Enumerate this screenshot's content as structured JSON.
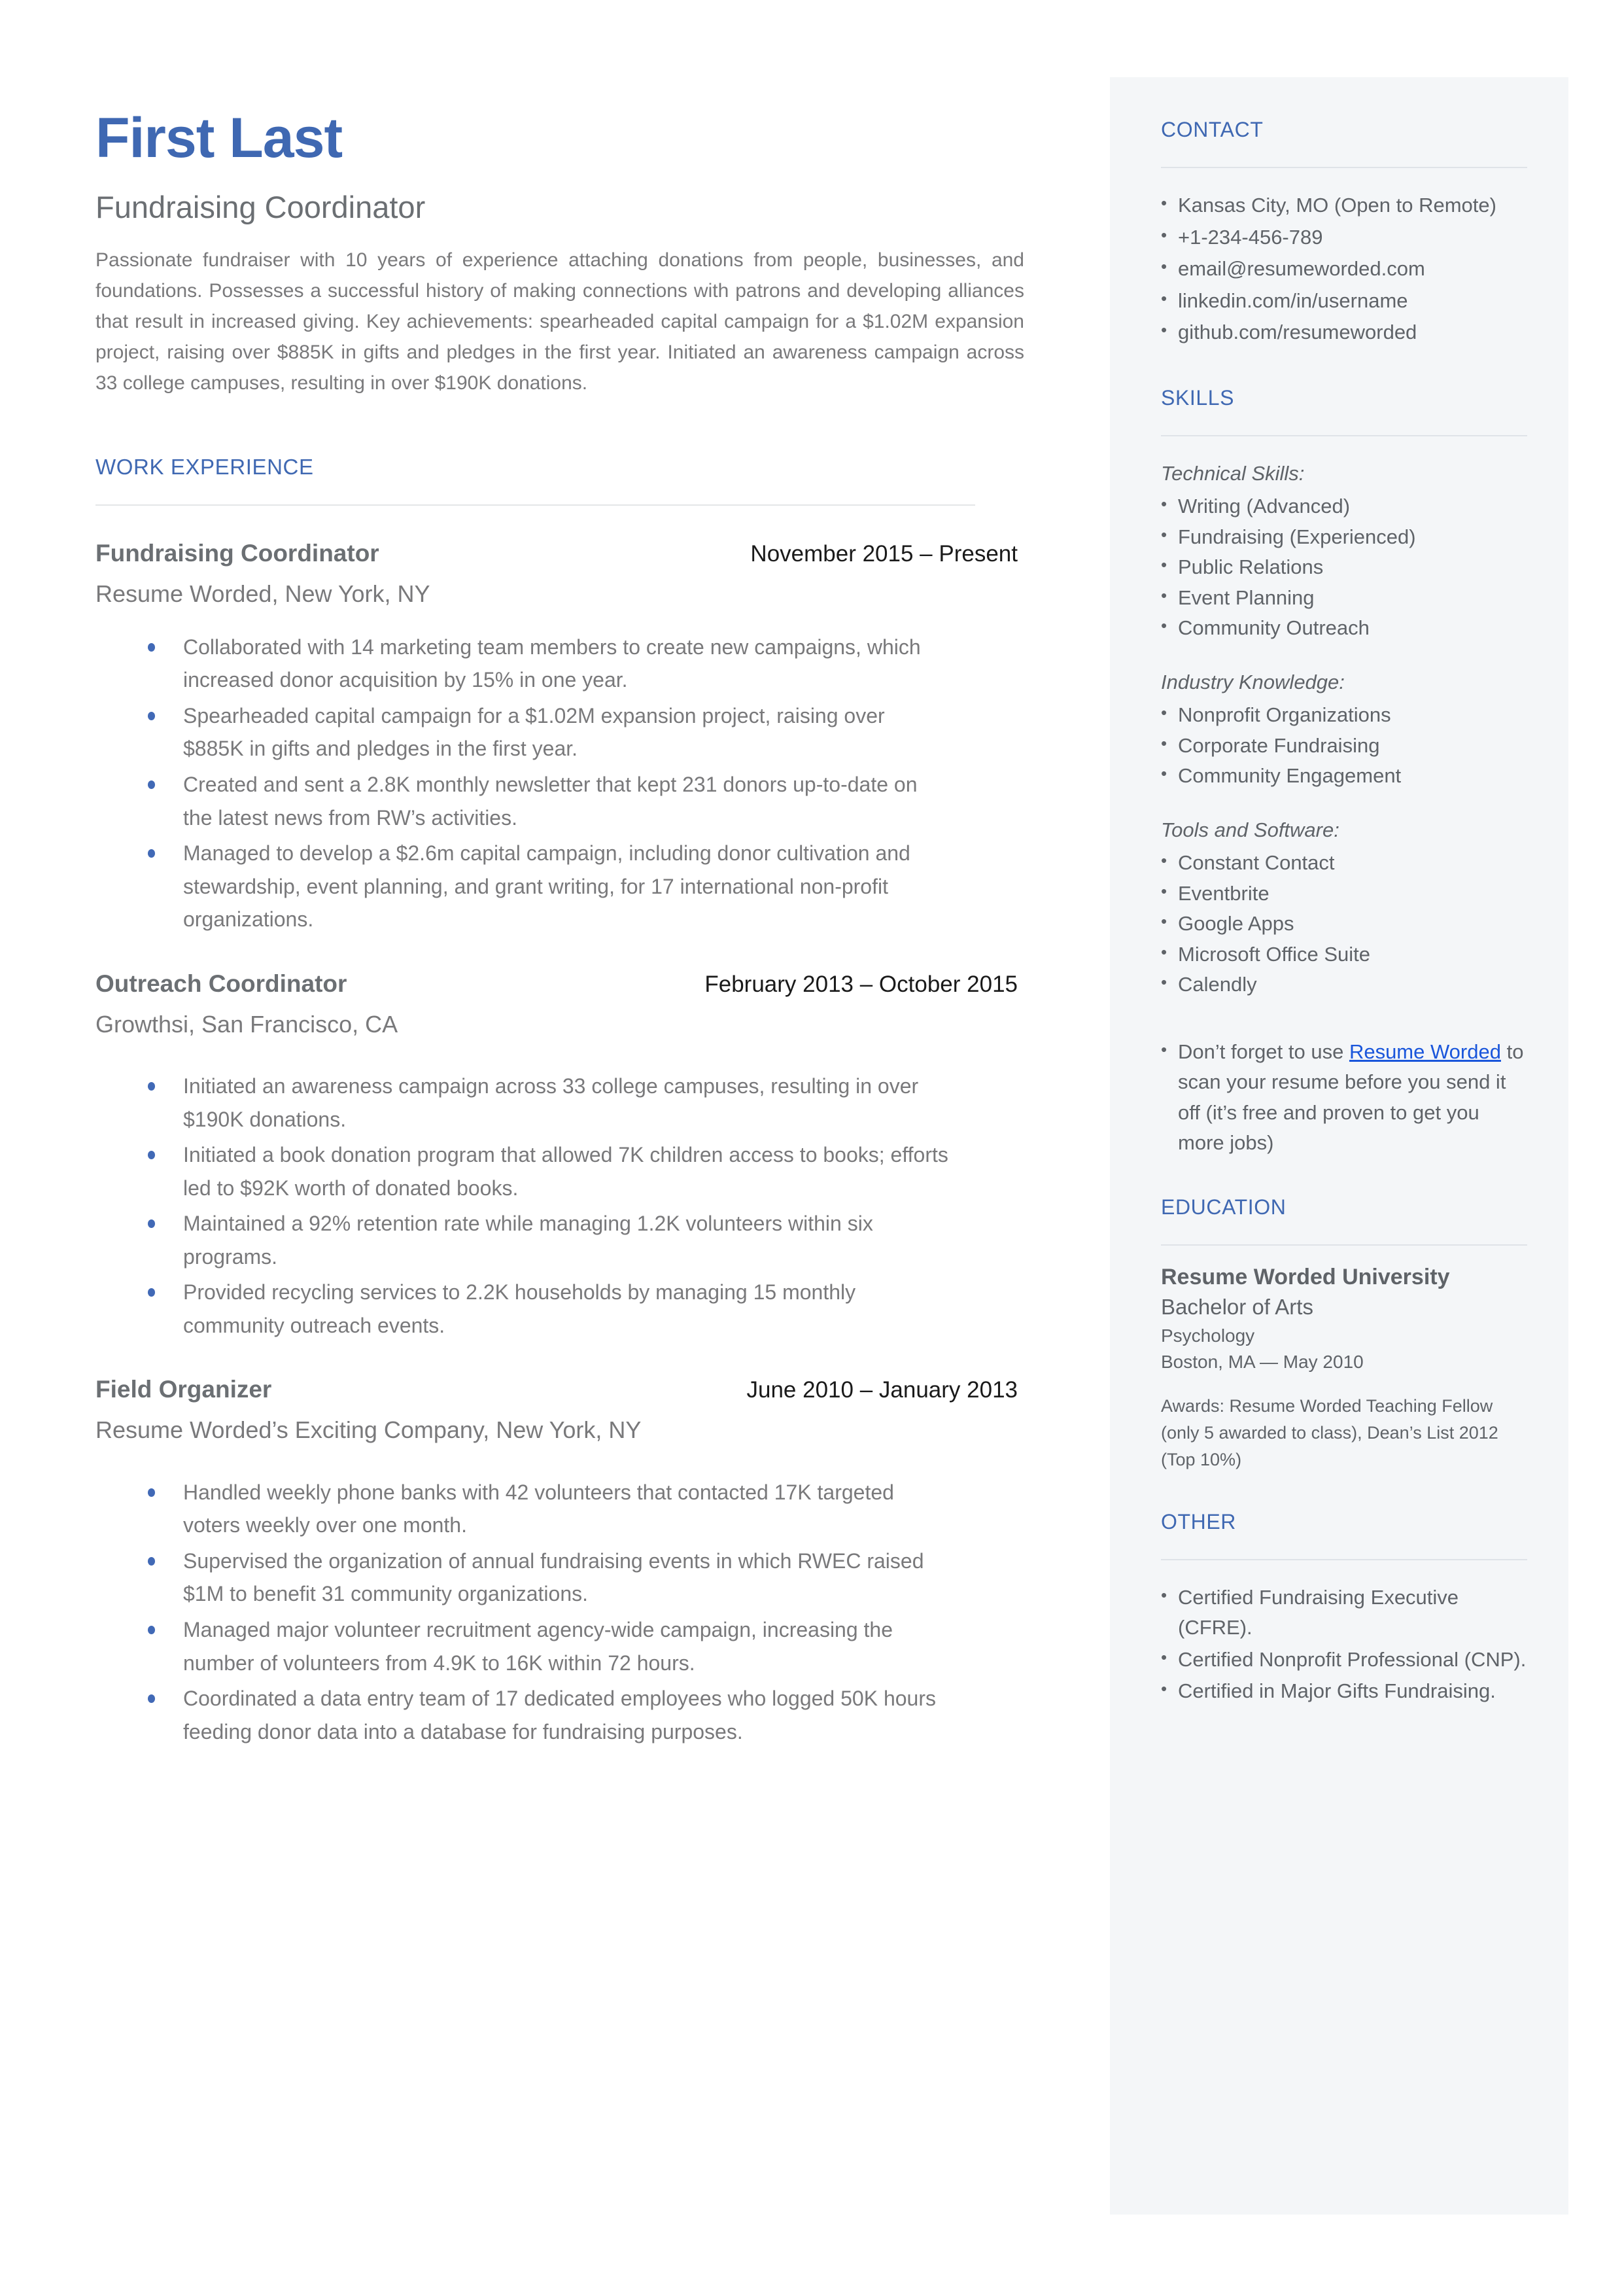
{
  "colors": {
    "accent_blue": "#3f68b2",
    "bullet_blue": "#4169b6",
    "link_blue": "#1a56db",
    "body_gray": "#79797b",
    "sidebar_bg": "#f4f6f8"
  },
  "header": {
    "name": "First Last",
    "role": "Fundraising Coordinator",
    "summary": "Passionate fundraiser with 10 years of experience attaching donations from people, businesses, and foundations. Possesses a successful history of making connections with patrons and developing alliances that result in increased giving. Key achievements: spearheaded capital campaign for a $1.02M expansion project, raising over $885K in gifts and pledges in the first year. Initiated an awareness campaign across 33 college campuses, resulting in over $190K donations."
  },
  "work_experience": {
    "heading": "WORK EXPERIENCE",
    "jobs": [
      {
        "title": "Fundraising Coordinator",
        "dates": "November 2015 – Present",
        "company": "Resume Worded, New York, NY",
        "bullets": [
          "Collaborated with 14 marketing team members to create new campaigns, which increased donor acquisition by 15% in one year.",
          "Spearheaded capital campaign for a $1.02M expansion project, raising over $885K in gifts and pledges in the first year.",
          "Created and sent a 2.8K monthly newsletter that kept 231 donors up-to-date on the latest news from RW’s activities.",
          "Managed to develop a $2.6m capital campaign, including donor cultivation and stewardship, event planning, and grant writing, for 17 international non-profit organizations."
        ]
      },
      {
        "title": "Outreach Coordinator",
        "dates": "February 2013 – October 2015",
        "company": "Growthsi, San Francisco, CA",
        "bullets": [
          "Initiated an awareness campaign across 33 college campuses, resulting in over $190K donations.",
          "Initiated a book donation program that allowed 7K children access to books; efforts led to $92K worth of donated books.",
          "Maintained a 92% retention rate while managing 1.2K volunteers within six programs.",
          "Provided recycling services to  2.2K households by managing 15 monthly community outreach events."
        ]
      },
      {
        "title": "Field Organizer",
        "dates": "June 2010 – January 2013",
        "company": "Resume Worded’s Exciting Company, New York, NY",
        "bullets": [
          "Handled weekly phone banks with 42 volunteers that contacted 17K targeted voters weekly over one month.",
          "Supervised the organization of annual fundraising events in which RWEC raised $1M to benefit 31 community organizations.",
          "Managed major volunteer recruitment agency-wide campaign, increasing the number of volunteers from  4.9K to 16K within 72 hours.",
          "Coordinated a data entry team of 17 dedicated employees who logged 50K hours feeding donor data into a database for fundraising purposes."
        ]
      }
    ]
  },
  "sidebar": {
    "contact": {
      "heading": "CONTACT",
      "items": [
        "Kansas City, MO (Open to Remote)",
        "+1-234-456-789",
        "email@resumeworded.com",
        "linkedin.com/in/username",
        "github.com/resumeworded"
      ]
    },
    "skills": {
      "heading": "SKILLS",
      "groups": [
        {
          "label": "Technical Skills:",
          "items": [
            "Writing (Advanced)",
            "Fundraising (Experienced)",
            "Public Relations",
            "Event Planning",
            "Community Outreach"
          ]
        },
        {
          "label": "Industry Knowledge:",
          "items": [
            "Nonprofit Organizations",
            "Corporate Fundraising",
            "Community Engagement"
          ]
        },
        {
          "label": "Tools and Software:",
          "items": [
            "Constant Contact",
            "Eventbrite",
            "Google Apps",
            "Microsoft Office Suite",
            "Calendly"
          ]
        }
      ],
      "promo": {
        "before": "Don’t forget to use ",
        "link": "Resume Worded",
        "after": " to scan your resume before you send it off (it’s free and proven to get you more jobs)"
      }
    },
    "education": {
      "heading": "EDUCATION",
      "school": "Resume Worded University",
      "degree": "Bachelor of Arts",
      "field": "Psychology",
      "location_date": "Boston, MA — May 2010",
      "awards": "Awards: Resume Worded Teaching Fellow (only 5 awarded to class), Dean’s List 2012 (Top 10%)"
    },
    "other": {
      "heading": "OTHER",
      "items": [
        "Certified Fundraising Executive (CFRE).",
        "Certified Nonprofit Professional (CNP).",
        "Certified in Major Gifts Fundraising."
      ]
    }
  }
}
